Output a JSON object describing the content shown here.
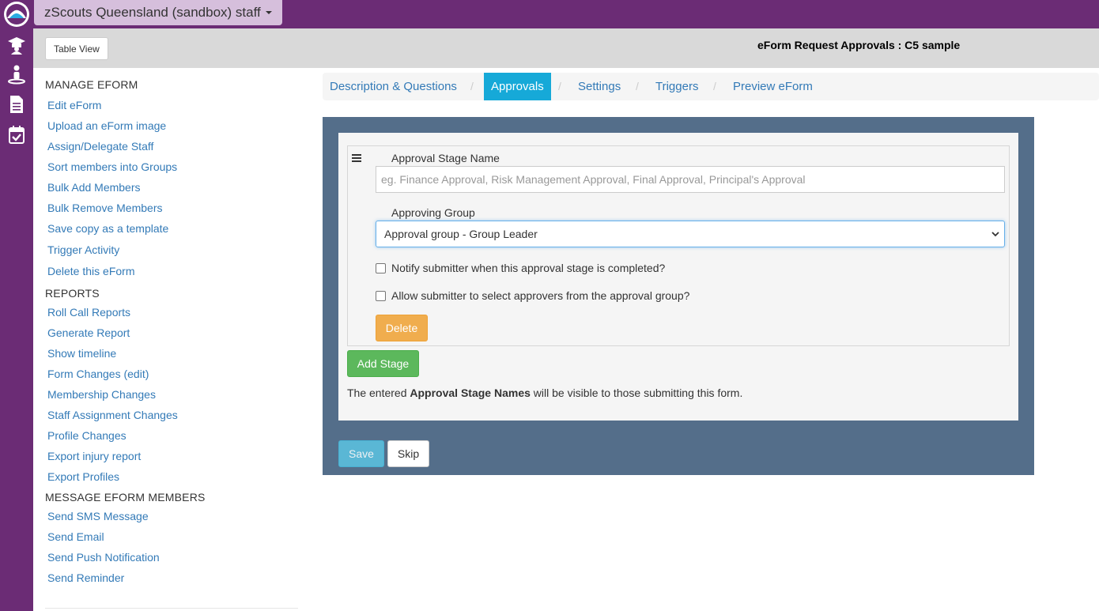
{
  "org": {
    "name": "zScouts Queensland (sandbox) staff"
  },
  "header": {
    "table_view_label": "Table View",
    "page_title": "eForm Request Approvals : C5 sample"
  },
  "rail": {
    "icons": [
      "logo-icon",
      "graduation-icon",
      "person-icon",
      "document-icon",
      "calendar-check-icon"
    ]
  },
  "sidebar": {
    "sections": [
      {
        "title": "MANAGE EFORM",
        "items": [
          "Edit eForm",
          "Upload an eForm image",
          "Assign/Delegate Staff",
          "Sort members into Groups",
          "Bulk Add Members",
          "Bulk Remove Members",
          "Save copy as a template",
          "Trigger Activity",
          "Delete this eForm"
        ]
      },
      {
        "title": "REPORTS",
        "items": [
          "Roll Call Reports",
          "Generate Report",
          "Show timeline",
          "Form Changes (edit)",
          "Membership Changes",
          "Staff Assignment Changes",
          "Profile Changes",
          "Export injury report",
          "Export Profiles"
        ]
      },
      {
        "title": "MESSAGE EFORM MEMBERS",
        "items": [
          "Send SMS Message",
          "Send Email",
          "Send Push Notification",
          "Send Reminder"
        ]
      }
    ]
  },
  "tabs": {
    "items": [
      "Description & Questions",
      "Approvals",
      "Settings",
      "Triggers",
      "Preview eForm"
    ],
    "active": "Approvals",
    "separator": "/"
  },
  "stage": {
    "name_label": "Approval Stage Name",
    "name_placeholder": "eg. Finance Approval, Risk Management Approval, Final Approval, Principal's Approval",
    "name_value": "",
    "group_label": "Approving Group",
    "group_value": "Approval group - Group Leader",
    "notify_label": "Notify submitter when this approval stage is completed?",
    "notify_checked": false,
    "allow_label": "Allow submitter to select approvers from the approval group?",
    "allow_checked": false,
    "delete_label": "Delete"
  },
  "actions": {
    "add_stage_label": "Add Stage",
    "save_label": "Save",
    "skip_label": "Skip"
  },
  "note": {
    "prefix": "The entered ",
    "bold": "Approval Stage Names",
    "suffix": " will be visible to those submitting this form."
  },
  "colors": {
    "brand_purple": "#6b2c75",
    "panel": "#546e8a",
    "link": "#337ab7",
    "active_tab": "#16a9d8",
    "delete": "#f0ad4e",
    "add": "#5cb85c",
    "save": "#5bc0de"
  }
}
